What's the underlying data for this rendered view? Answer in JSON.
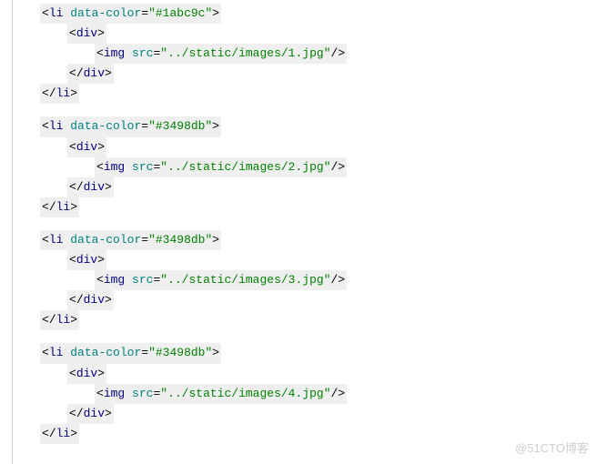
{
  "watermark": "@51CTO博客",
  "syntax": {
    "lt": "<",
    "gt": ">",
    "slash": "/",
    "eq": "=",
    "q": "\"",
    "selfclose": "/>"
  },
  "tags": {
    "li": "li",
    "div": "div",
    "img": "img"
  },
  "attrs": {
    "data_color": "data-color",
    "src": "src"
  },
  "blocks": [
    {
      "color": "#1abc9c",
      "src": "../static/images/1.jpg"
    },
    {
      "color": "#3498db",
      "src": "../static/images/2.jpg"
    },
    {
      "color": "#3498db",
      "src": "../static/images/3.jpg"
    },
    {
      "color": "#3498db",
      "src": "../static/images/4.jpg"
    }
  ]
}
